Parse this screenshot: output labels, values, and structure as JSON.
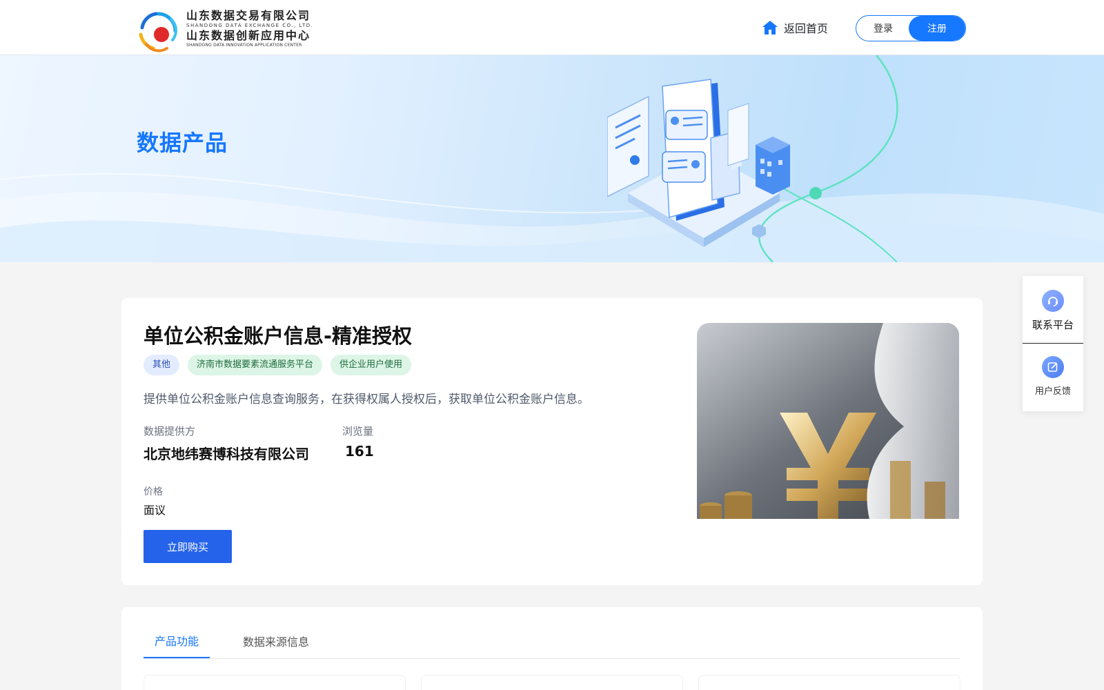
{
  "header": {
    "logo": {
      "line1": "山东数据交易有限公司",
      "line2": "SHANDONG DATA EXCHANGE CO., LTD.",
      "line3": "山东数据创新应用中心",
      "line4": "SHANDONG DATA INNOVATION APPLICATION CENTER"
    },
    "home_label": "返回首页",
    "login_label": "登录",
    "register_label": "注册",
    "accent": "#1677ff"
  },
  "banner": {
    "title": "数据产品"
  },
  "product": {
    "title": "单位公积金账户信息-精准授权",
    "tags": [
      {
        "label": "其他",
        "color": "#e3ecff"
      },
      {
        "label": "济南市数据要素流通服务平台",
        "color": "#dcf5e6"
      },
      {
        "label": "供企业用户使用",
        "color": "#dcf5e6"
      }
    ],
    "description": "提供单位公积金账户信息查询服务，在获得权属人授权后，获取单位公积金账户信息。",
    "provider_label": "数据提供方",
    "provider_value": "北京地纬赛博科技有限公司",
    "views_label": "浏览量",
    "views_value": "161",
    "price_label": "价格",
    "price_value": "面议",
    "buy_label": "立即购买",
    "image_icon": "yen-hourglass-photo"
  },
  "side": {
    "contact_label": "联系平台",
    "contact_icon": "headset-icon",
    "feedback_label": "用户反馈",
    "feedback_icon": "edit-icon"
  },
  "tabs": [
    {
      "label": "产品功能",
      "active": true
    },
    {
      "label": "数据来源信息",
      "active": false
    }
  ]
}
